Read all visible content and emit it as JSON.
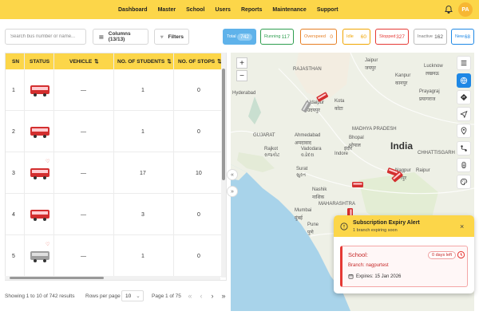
{
  "nav": {
    "items": [
      "Dashboard",
      "Master",
      "School",
      "Users",
      "Reports",
      "Maintenance",
      "Support"
    ],
    "avatar_initials": "PA"
  },
  "toolbar": {
    "search_placeholder": "Search bus number or name...",
    "columns_label": "Columns (13/13)",
    "filters_label": "Filters"
  },
  "status_chips": [
    {
      "label": "Total",
      "count": "742",
      "color": "#5fb2ea"
    },
    {
      "label": "Running",
      "count": "117",
      "color": "#2e9e4f"
    },
    {
      "label": "Overspeed",
      "count": "0",
      "color": "#e67e22"
    },
    {
      "label": "Idle",
      "count": "60",
      "color": "#f0a500"
    },
    {
      "label": "Stopped",
      "count": "327",
      "color": "#e53935"
    },
    {
      "label": "Inactive",
      "count": "162",
      "color": "#777777"
    },
    {
      "label": "New",
      "count": "68",
      "color": "#1e88e5"
    }
  ],
  "table": {
    "headers": [
      "SN",
      "STATUS",
      "VEHICLE",
      "NO. OF STUDENTS",
      "NO. OF STOPS"
    ],
    "rows": [
      {
        "sn": "1",
        "vehicle": "—",
        "students": "1",
        "stops": "0",
        "bus_color": "#d32f2f",
        "heart": false
      },
      {
        "sn": "2",
        "vehicle": "—",
        "students": "1",
        "stops": "0",
        "bus_color": "#d32f2f",
        "heart": false
      },
      {
        "sn": "3",
        "vehicle": "—",
        "students": "17",
        "stops": "10",
        "bus_color": "#d32f2f",
        "heart": true
      },
      {
        "sn": "4",
        "vehicle": "—",
        "students": "3",
        "stops": "0",
        "bus_color": "#d32f2f",
        "heart": false
      },
      {
        "sn": "5",
        "vehicle": "—",
        "students": "1",
        "stops": "0",
        "bus_color": "#9e9e9e",
        "heart": true
      }
    ]
  },
  "pagination": {
    "showing": "Showing 1 to 10 of 742 results",
    "rows_per_page_label": "Rows per page",
    "rows_per_page_value": "10",
    "page_info": "Page 1 of 75"
  },
  "map": {
    "labels": {
      "rajasthan": "RAJASTHAN",
      "hyderabad": "Hyderabad",
      "jaipur": "Jaipur",
      "jaipur_local": "जयपुर",
      "lucknow": "Lucknow",
      "lucknow_local": "लखनऊ",
      "kanpur": "Kanpur",
      "kanpur_local": "कानपुर",
      "prayagraj": "Prayagraj",
      "prayagraj_local": "प्रयागराज",
      "gujarat": "GUJARAT",
      "ahmedabad": "Ahmedabad",
      "ahmedabad_local": "अमदावाद",
      "udaipur": "Udaipur",
      "udaipur_local": "उदयपुर",
      "kota": "Kota",
      "kota_local": "कोटा",
      "madhya_pradesh": "MADHYA PRADESH",
      "rajkot": "Rajkot",
      "rajkot_local": "રાજકોટ",
      "vadodara": "Vadodara",
      "vadodara_local": "વડોદરા",
      "bhopal": "Bhopal",
      "bhopal_local": "भोपाल",
      "indore": "Indore",
      "indore_local": "इंदौर",
      "india": "India",
      "chhattisgarh": "CHHATTISGARH",
      "raipur": "Raipur",
      "surat": "Surat",
      "surat_local": "સુરત",
      "nagpur": "Nagpur",
      "nagpur_local": "नागपुर",
      "nashik": "Nashik",
      "nashik_local": "नाशिक",
      "maharashtra": "MAHARASHTRA",
      "mumbai": "Mumbai",
      "mumbai_local": "मुंबई",
      "pune": "Pune",
      "pune_local": "पुणे"
    },
    "zoom_in": "+",
    "zoom_out": "−"
  },
  "alert": {
    "title": "Subscription Expiry Alert",
    "subtitle": "1 branch expiring soon",
    "school_label": "School:",
    "days_left": "0 days left",
    "branch": "Branch: nagpurtest",
    "expires": "Expires:  15 Jan 2026"
  }
}
